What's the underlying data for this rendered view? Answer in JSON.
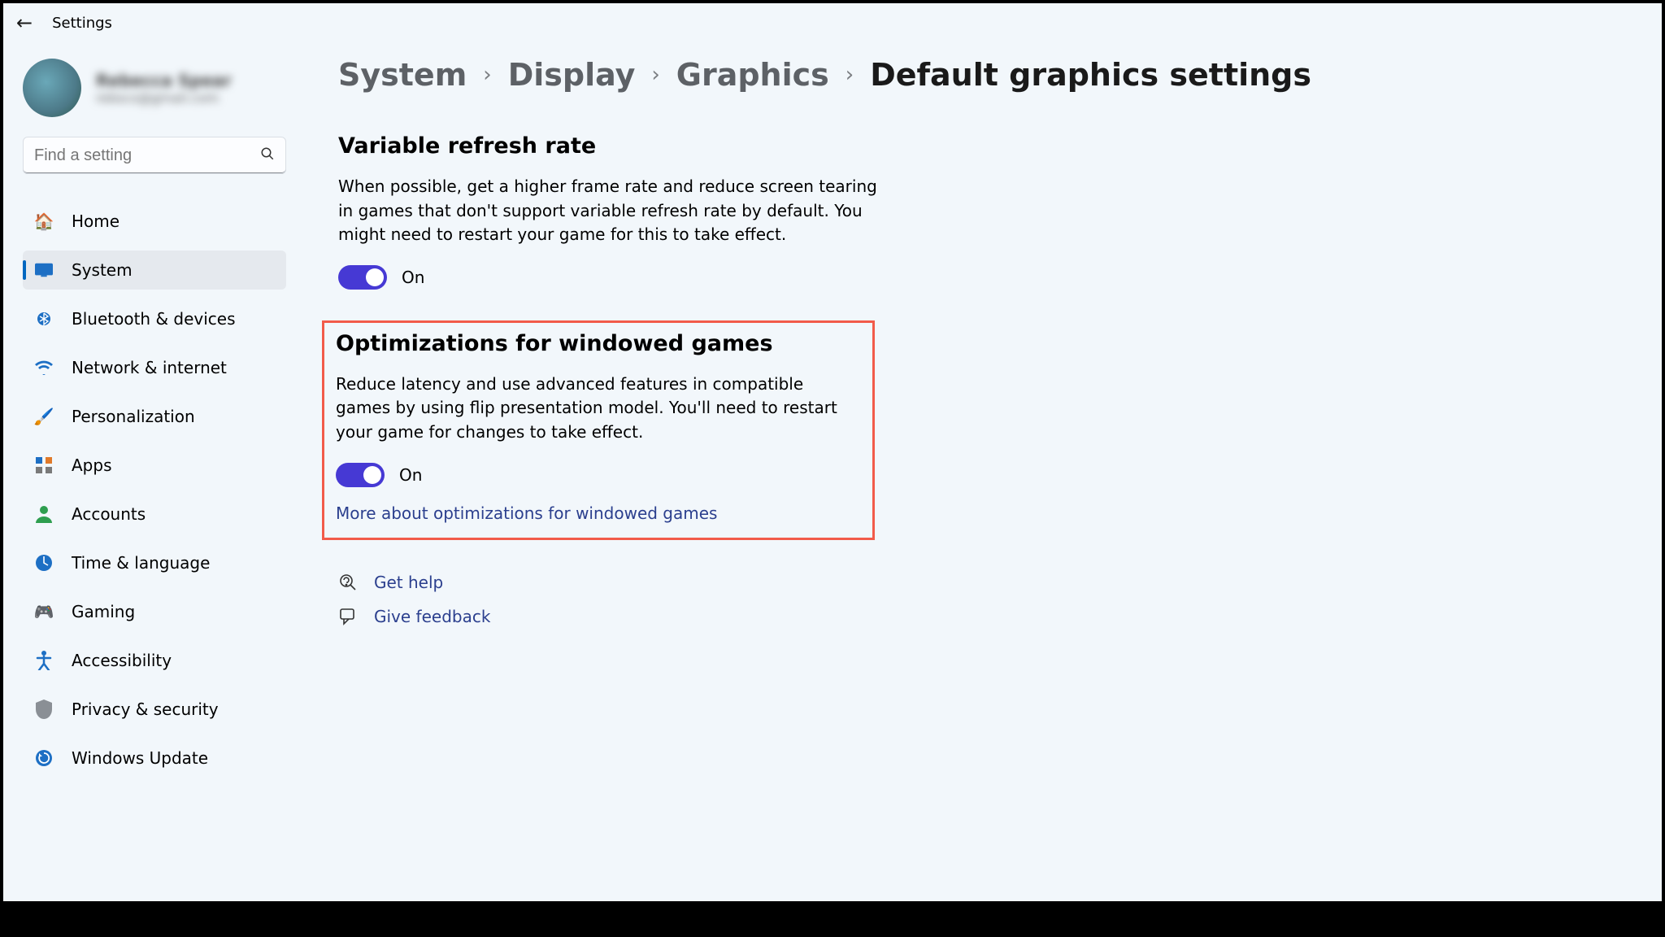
{
  "app_title": "Settings",
  "user": {
    "name": "Rebecca Spear",
    "email": "rebscs@gmail.com"
  },
  "search": {
    "placeholder": "Find a setting"
  },
  "nav": {
    "items": [
      {
        "label": "Home"
      },
      {
        "label": "System"
      },
      {
        "label": "Bluetooth & devices"
      },
      {
        "label": "Network & internet"
      },
      {
        "label": "Personalization"
      },
      {
        "label": "Apps"
      },
      {
        "label": "Accounts"
      },
      {
        "label": "Time & language"
      },
      {
        "label": "Gaming"
      },
      {
        "label": "Accessibility"
      },
      {
        "label": "Privacy & security"
      },
      {
        "label": "Windows Update"
      }
    ],
    "active_index": 1
  },
  "breadcrumb": {
    "parts": [
      "System",
      "Display",
      "Graphics"
    ],
    "current": "Default graphics settings"
  },
  "sections": {
    "vrr": {
      "heading": "Variable refresh rate",
      "body": "When possible, get a higher frame rate and reduce screen tearing in games that don't support variable refresh rate by default. You might need to restart your game for this to take effect.",
      "toggle_state": "On"
    },
    "owg": {
      "heading": "Optimizations for windowed games",
      "body": "Reduce latency and use advanced features in compatible games by using flip presentation model. You'll need to restart your game for changes to take effect.",
      "toggle_state": "On",
      "more_link": "More about optimizations for windowed games"
    }
  },
  "help": {
    "get_help": "Get help",
    "give_feedback": "Give feedback"
  }
}
